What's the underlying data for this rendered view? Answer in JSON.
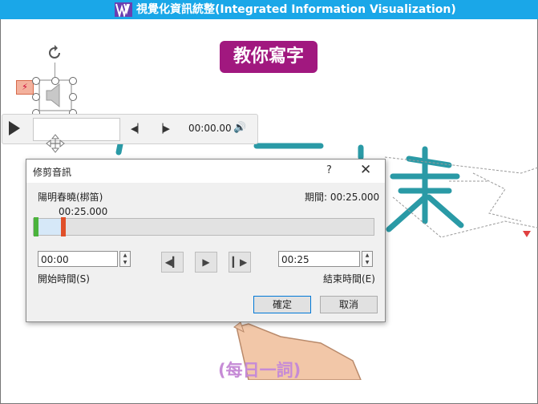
{
  "app": {
    "title": "視覺化資訊統整(Integrated Information Visualization)",
    "slide_badge": "教你寫字",
    "footer": "(每日一詞)"
  },
  "player": {
    "time": "00:00.00"
  },
  "icons": {
    "logo": "vv-logo-icon",
    "rotate": "rotate-icon",
    "speaker": "speaker-icon",
    "play": "play-icon",
    "prev": "step-back-icon",
    "next": "step-forward-icon",
    "volume": "volume-icon",
    "move": "move-icon",
    "close": "close-icon"
  },
  "dialog": {
    "title": "修剪音訊",
    "help": "?",
    "close": "✕",
    "filename": "陽明春曉(梆笛)",
    "duration": "期間: 00:25.000",
    "marker_time": "00:25.000",
    "start_value": "00:00",
    "end_value": "00:25",
    "start_label": "開始時間(S)",
    "end_label": "結束時間(E)",
    "ok": "確定",
    "cancel": "取消"
  },
  "colors": {
    "titlebar": "#1aa7e8",
    "badge": "#a1187f",
    "footer": "#c68bd6",
    "calligraphy": "#2a9aa6"
  }
}
